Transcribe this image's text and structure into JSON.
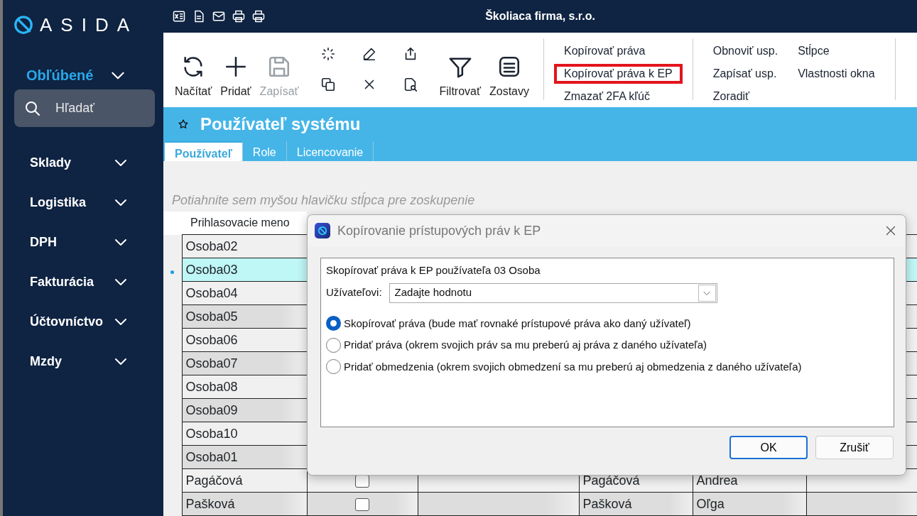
{
  "app": {
    "logo": "ASIDA",
    "company": "Školiaca firma, s.r.o."
  },
  "sidebar": {
    "favorites": {
      "label": "Obľúbené",
      "expanded": false
    },
    "search": {
      "placeholder": "Hľadať"
    },
    "items": [
      {
        "label": "Sklady",
        "expanded": false
      },
      {
        "label": "Logistika",
        "expanded": false
      },
      {
        "label": "DPH",
        "expanded": false
      },
      {
        "label": "Fakturácia",
        "expanded": false
      },
      {
        "label": "Účtovníctvo",
        "expanded": false
      },
      {
        "label": "Mzdy",
        "expanded": false
      }
    ]
  },
  "toolbar": {
    "buttons": [
      {
        "label": "Načítať",
        "disabled": false
      },
      {
        "label": "Pridať",
        "disabled": false
      },
      {
        "label": "Zapísať",
        "disabled": true
      },
      {
        "label": "Filtrovať",
        "disabled": false
      },
      {
        "label": "Zostavy",
        "disabled": false
      }
    ],
    "link_sections": [
      {
        "columns": [
          [
            {
              "label": "Kopírovať práva",
              "highlighted": false
            },
            {
              "label": "Kopírovať práva k EP",
              "highlighted": true
            },
            {
              "label": "Zmazať 2FA kľúč",
              "highlighted": false
            }
          ]
        ]
      },
      {
        "columns": [
          [
            {
              "label": "Obnoviť usp.",
              "highlighted": false
            },
            {
              "label": "Zapísať usp.",
              "highlighted": false
            },
            {
              "label": "Zoradiť",
              "highlighted": false
            }
          ],
          [
            {
              "label": "Stĺpce",
              "highlighted": false
            },
            {
              "label": "Vlastnosti okna",
              "highlighted": false
            }
          ]
        ]
      }
    ]
  },
  "page": {
    "title": "Používateľ systému",
    "tabs": [
      {
        "label": "Používateľ",
        "selected": true
      },
      {
        "label": "Role",
        "selected": false
      },
      {
        "label": "Licencovanie",
        "selected": false
      }
    ]
  },
  "grid": {
    "group_hint": "Potiahnite sem myšou hlavičku stĺpca pre zoskupenie",
    "columns": [
      "Prihlasovacie meno"
    ],
    "rows": [
      {
        "login": "Osoba02",
        "selected": false
      },
      {
        "login": "Osoba03",
        "selected": true
      },
      {
        "login": "Osoba04",
        "selected": false
      },
      {
        "login": "Osoba05",
        "selected": false
      },
      {
        "login": "Osoba06",
        "selected": false
      },
      {
        "login": "Osoba07",
        "selected": false
      },
      {
        "login": "Osoba08",
        "selected": false
      },
      {
        "login": "Osoba09",
        "selected": false
      },
      {
        "login": "Osoba10",
        "selected": false
      },
      {
        "login": "Osoba01",
        "selected": false
      },
      {
        "login": "Pagáčová",
        "selected": false,
        "checked": false,
        "surname": "Pagáčová",
        "first_name": "Andrea"
      },
      {
        "login": "Pašková",
        "selected": false,
        "checked": false,
        "surname": "Pašková",
        "first_name": "Oľga"
      }
    ]
  },
  "dialog": {
    "title": "Kopírovanie prístupových práv k EP",
    "message": "Skopírovať práva k EP používateľa 03 Osoba",
    "user_label": "Užívateľovi:",
    "user_select": {
      "placeholder": "Zadajte hodnotu"
    },
    "options": [
      {
        "label": "Skopírovať práva (bude mať rovnaké prístupové práva ako daný užívateľ)",
        "selected": true
      },
      {
        "label": "Pridať práva (okrem svojich práv sa mu preberú aj práva z daného užívateľa)",
        "selected": false
      },
      {
        "label": "Pridať obmedzenia (okrem svojich obmedzení sa mu preberú aj obmedzenia z daného užívateľa)",
        "selected": false
      }
    ],
    "buttons": [
      {
        "label": "OK",
        "default": true
      },
      {
        "label": "Zrušiť",
        "default": false
      }
    ]
  }
}
